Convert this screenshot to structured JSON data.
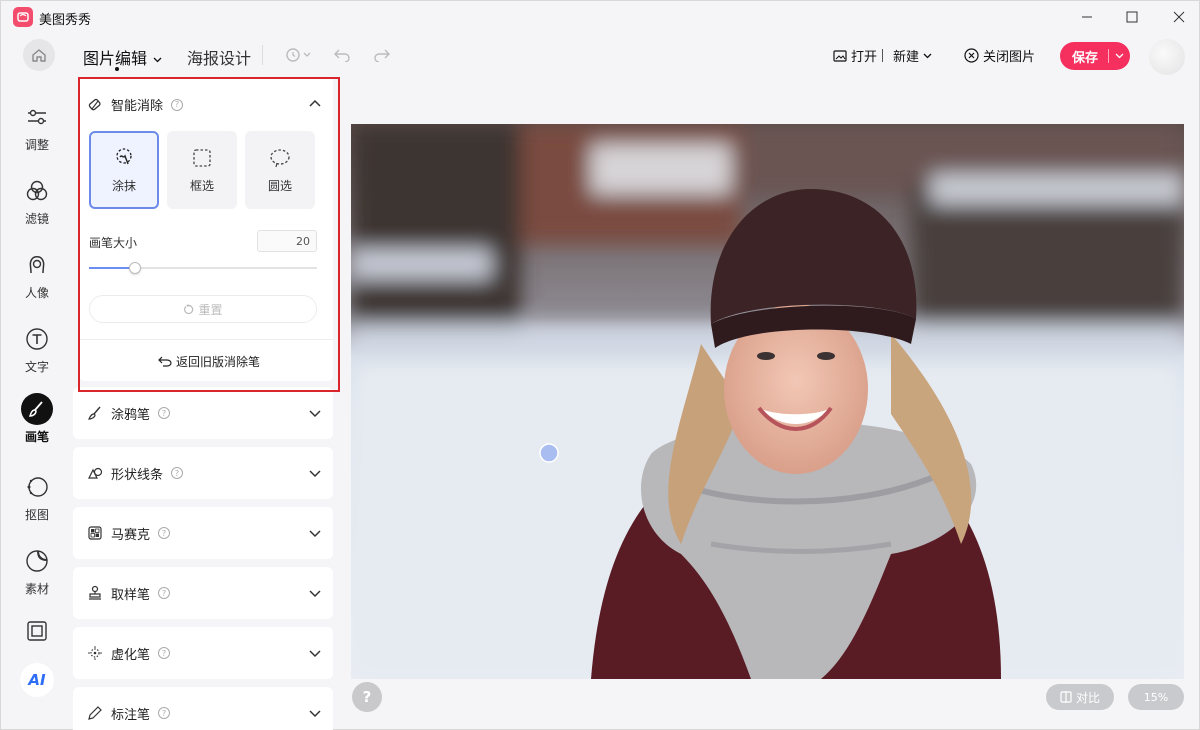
{
  "app": {
    "title": "美图秀秀"
  },
  "toolbar": {
    "tab_edit": "图片编辑",
    "tab_poster": "海报设计",
    "open_label": "打开",
    "new_label": "新建",
    "close_label": "关闭图片",
    "save_label": "保存"
  },
  "rail": {
    "items": [
      {
        "label": "调整",
        "icon": "sliders-icon"
      },
      {
        "label": "滤镜",
        "icon": "filter-circles-icon"
      },
      {
        "label": "人像",
        "icon": "portrait-icon"
      },
      {
        "label": "文字",
        "icon": "text-t-icon"
      },
      {
        "label": "画笔",
        "icon": "brush-icon",
        "active": true
      },
      {
        "label": "抠图",
        "icon": "cutout-icon"
      },
      {
        "label": "素材",
        "icon": "sticker-icon"
      },
      {
        "label": "",
        "icon": "frame-icon"
      }
    ],
    "ai_label": "AI"
  },
  "panel": {
    "smart_erase": {
      "title": "智能消除",
      "modes": [
        {
          "label": "涂抹",
          "selected": true
        },
        {
          "label": "框选"
        },
        {
          "label": "圆选"
        }
      ],
      "size_label": "画笔大小",
      "size_value": "20",
      "size_fraction": 0.2,
      "reset_label": "重置",
      "legacy_label": "返回旧版消除笔"
    },
    "tools": [
      {
        "label": "涂鸦笔",
        "icon": "brush-small-icon"
      },
      {
        "label": "形状线条",
        "icon": "shapes-icon"
      },
      {
        "label": "马赛克",
        "icon": "mosaic-icon"
      },
      {
        "label": "取样笔",
        "icon": "stamp-icon"
      },
      {
        "label": "虚化笔",
        "icon": "blur-icon"
      },
      {
        "label": "标注笔",
        "icon": "pen-icon"
      }
    ]
  },
  "canvas": {
    "compare_label": "对比",
    "zoom_label": "15%",
    "help_label": "?"
  },
  "colors": {
    "accent": "#f5305f",
    "selected_border": "#6d8ae8",
    "highlight_box": "#d9262c"
  }
}
